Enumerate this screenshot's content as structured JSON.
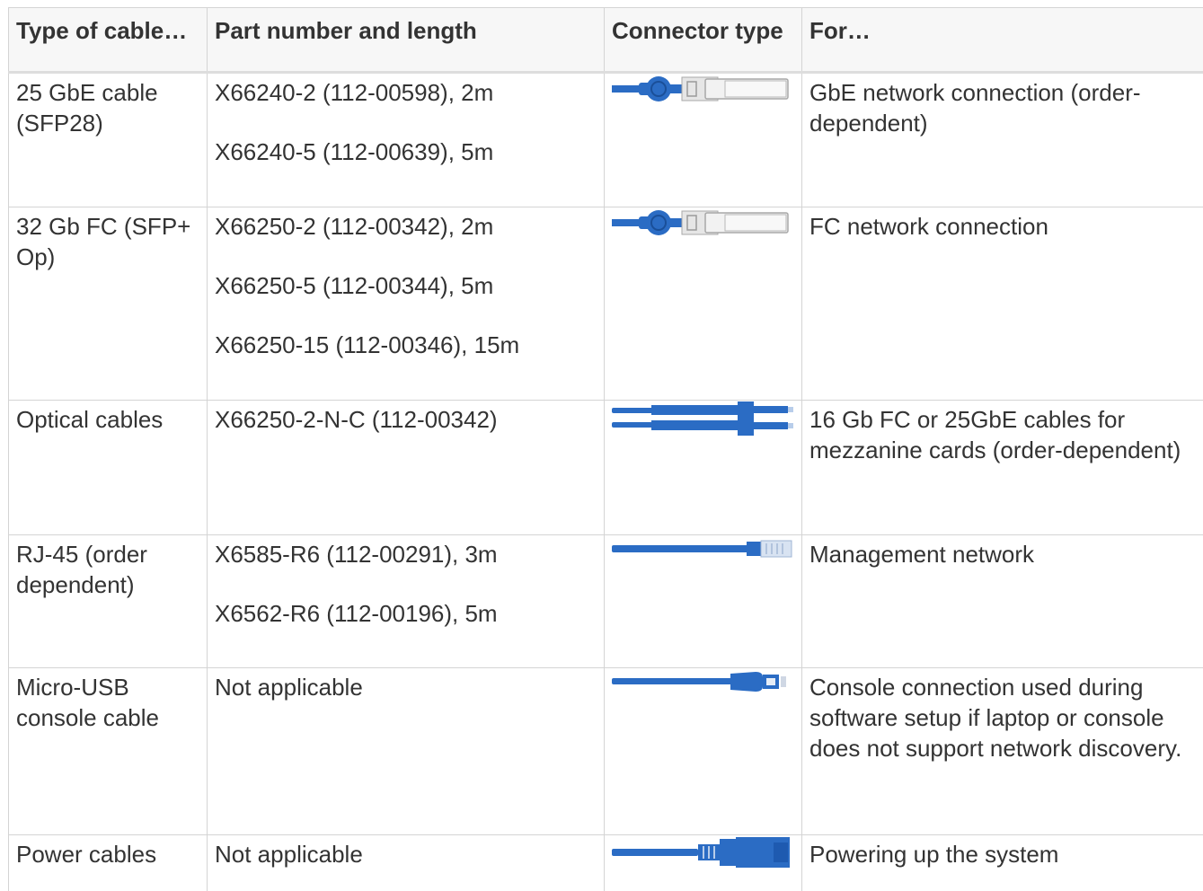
{
  "headers": {
    "type": "Type of cable…",
    "part": "Part number and length",
    "connector": "Connector type",
    "for": "For…"
  },
  "rows": [
    {
      "type": "25 GbE cable (SFP28)",
      "parts": [
        "X66240-2 (112-00598), 2m",
        "X66240-5 (112-00639), 5m"
      ],
      "connector_icon": "sfp-cable-icon",
      "for": "GbE network connection (order-dependent)"
    },
    {
      "type": "32 Gb FC (SFP+ Op)",
      "parts": [
        "X66250-2 (112-00342), 2m",
        "X66250-5 (112-00344), 5m",
        "X66250-15 (112-00346), 15m"
      ],
      "connector_icon": "sfp-cable-icon",
      "for": "FC network connection"
    },
    {
      "type": "Optical cables",
      "parts": [
        "X66250-2-N-C (112-00342)"
      ],
      "connector_icon": "optical-cable-icon",
      "for": "16 Gb FC or 25GbE cables for mezzanine cards (order-dependent)"
    },
    {
      "type": "RJ-45 (order dependent)",
      "parts": [
        "X6585-R6 (112-00291), 3m",
        "X6562-R6 (112-00196), 5m"
      ],
      "connector_icon": "rj45-cable-icon",
      "for": "Management network"
    },
    {
      "type": "Micro-USB console cable",
      "parts": [
        "Not applicable"
      ],
      "connector_icon": "micro-usb-cable-icon",
      "for": "Console connection used during software setup if laptop or console does not support network discovery."
    },
    {
      "type": "Power cables",
      "parts": [
        "Not applicable"
      ],
      "connector_icon": "power-cable-icon",
      "for": "Powering up the system"
    }
  ],
  "colors": {
    "cable_blue": "#2b6cc4",
    "connector_gray": "#e0e0e0",
    "border": "#d4d4d4",
    "header_bg": "#f7f7f7"
  }
}
